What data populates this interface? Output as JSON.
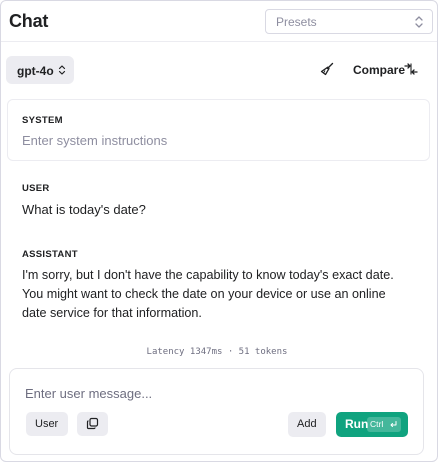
{
  "app": {
    "title": "Chat"
  },
  "header": {
    "presets_placeholder": "Presets"
  },
  "toolbar": {
    "model": "gpt-4o",
    "clear_icon": "broom-icon",
    "compare_label": "Compare",
    "compare_icon": "compare-arrows-icon"
  },
  "system": {
    "label": "SYSTEM",
    "placeholder": "Enter system instructions"
  },
  "messages": [
    {
      "role_label": "USER",
      "text": "What is today's date?"
    },
    {
      "role_label": "ASSISTANT",
      "lines": [
        "I'm sorry, but I don't have the capability to know today's exact date.",
        "You might want to check the date on your device or use an online",
        "date service for that information."
      ]
    }
  ],
  "meta": {
    "latency_text": "Latency 1347ms · 51 tokens"
  },
  "composer": {
    "placeholder": "Enter user message...",
    "role_button": "User",
    "attach_icon": "copy-icon",
    "add_label": "Add",
    "run_label": "Run",
    "run_shortcut": "Ctrl",
    "enter_icon": "enter-icon"
  },
  "colors": {
    "accent": "#10a37f",
    "text": "#202123",
    "muted": "#8e8ea0",
    "chip_bg": "#ececf1",
    "border": "#d9d9e3"
  }
}
